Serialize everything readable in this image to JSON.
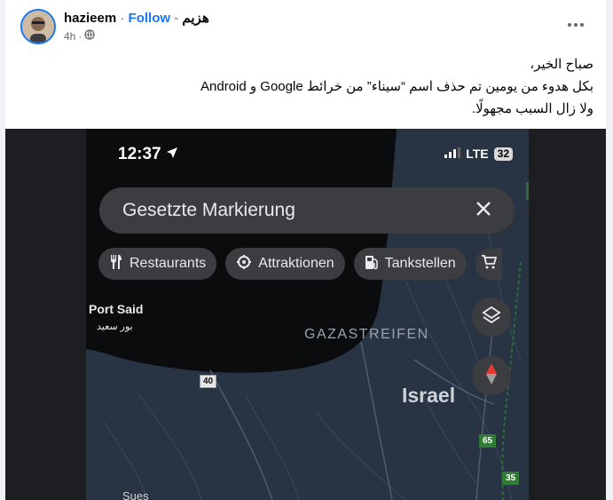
{
  "post": {
    "author_name": "hazieem",
    "dot": "·",
    "follow_label": "Follow",
    "dash": "-",
    "author_arabic": "هزيم",
    "time": "4h",
    "dot2": "·",
    "text_lines": [
      "صباح الخير،",
      "بكل هدوء من يومين تم حذف اسم “سيناء” من خرائط Google و Android",
      "ولا زال السبب مجهولًا."
    ]
  },
  "phone": {
    "time": "12:37",
    "network": "LTE",
    "battery": "32",
    "search_value": "Gesetzte Markierung",
    "chips": [
      "Restaurants",
      "Attraktionen",
      "Tankstellen"
    ]
  },
  "map": {
    "labels": {
      "port_said": "Port Said",
      "port_said_ar": "بور سعيد",
      "gaza": "GAZASTREIFEN",
      "israel": "Israel",
      "suez": "Sues"
    },
    "roads": {
      "r40": "40",
      "r65": "65",
      "r35": "35"
    }
  },
  "icons": [
    "profile-avatar",
    "globe-icon",
    "more-icon",
    "location-arrow-icon",
    "signal-icon",
    "close-icon",
    "restaurant-icon",
    "attraction-icon",
    "gas-station-icon",
    "cart-icon",
    "layers-icon",
    "compass-icon"
  ],
  "colors": {
    "follow": "#1877f2",
    "map_land": "#283443",
    "map_sea": "#0b0c0e",
    "chip_bg": "#3b3d40"
  }
}
